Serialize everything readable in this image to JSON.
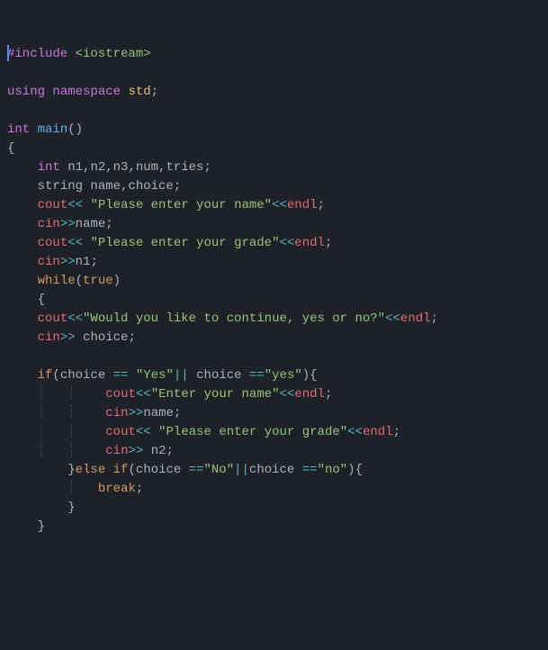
{
  "lines": {
    "0": {
      "a": "#include",
      "b": "<iostream>"
    },
    "2": {
      "a": "using",
      "b": "namespace",
      "c": "std",
      "d": ";"
    },
    "4": {
      "a": "int",
      "b": "main",
      "c": "()"
    },
    "5": {
      "a": "{"
    },
    "6": {
      "a": "int",
      "b": "n1,n2,n3,num,tries;"
    },
    "7": {
      "a": "string name,choice;"
    },
    "8": {
      "a": "cout",
      "b": "<<",
      "c": "\"Please enter your name\"",
      "d": "<<",
      "e": "endl",
      "f": ";"
    },
    "9": {
      "a": "cin",
      "b": ">>",
      "c": "name",
      "d": ";"
    },
    "10": {
      "a": "cout",
      "b": "<<",
      "c": "\"Please enter your grade\"",
      "d": "<<",
      "e": "endl",
      "f": ";"
    },
    "11": {
      "a": "cin",
      "b": ">>",
      "c": "n1",
      "d": ";"
    },
    "12": {
      "a": "while",
      "b": "(",
      "c": "true",
      "d": ")"
    },
    "13": {
      "a": "{"
    },
    "14": {
      "a": "cout",
      "b": "<<",
      "c": "\"Would you like to continue, yes or no?\"",
      "d": "<<",
      "e": "endl",
      "f": ";"
    },
    "15": {
      "a": "cin",
      "b": ">>",
      "c": "choice",
      "d": ";"
    },
    "17": {
      "a": "if",
      "b": "(",
      "c": "choice",
      "d": "==",
      "e": "\"Yes\"",
      "f": "||",
      "g": "choice",
      "h": "==",
      "i": "\"yes\"",
      "j": "){"
    },
    "18": {
      "g": "┊   ┊",
      "a": "cout",
      "b": "<<",
      "c": "\"Enter your name\"",
      "d": "<<",
      "e": "endl",
      "f": ";"
    },
    "19": {
      "g": "┊   ┊",
      "a": "cin",
      "b": ">>",
      "c": "name",
      "d": ";"
    },
    "20": {
      "g": "┊   ┊",
      "a": "cout",
      "b": "<<",
      "c": "\"Please enter your grade\"",
      "d": "<<",
      "e": "endl",
      "f": ";"
    },
    "21": {
      "g": "┊   ┊",
      "a": "cin",
      "b": ">>",
      "c": "n2",
      "d": ";"
    },
    "22": {
      "a": "}",
      "b": "else",
      "c": "if",
      "d": "(",
      "e": "choice",
      "f": "==",
      "g": "\"No\"",
      "h": "||",
      "i": "choice",
      "j": "==",
      "k": "\"no\"",
      "l": "){"
    },
    "23": {
      "g": "┊",
      "a": "break",
      "b": ";"
    },
    "24": {
      "a": "}"
    },
    "25": {
      "a": "}"
    }
  },
  "colors": {
    "background": "#1e2127",
    "default": "#abb2bf",
    "keyword": "#c678dd",
    "control": "#d19a66",
    "string": "#98c379",
    "function": "#61afef",
    "type": "#e5c07b",
    "operator": "#56b6c2",
    "object": "#e06c75",
    "cursor": "#528bff"
  }
}
